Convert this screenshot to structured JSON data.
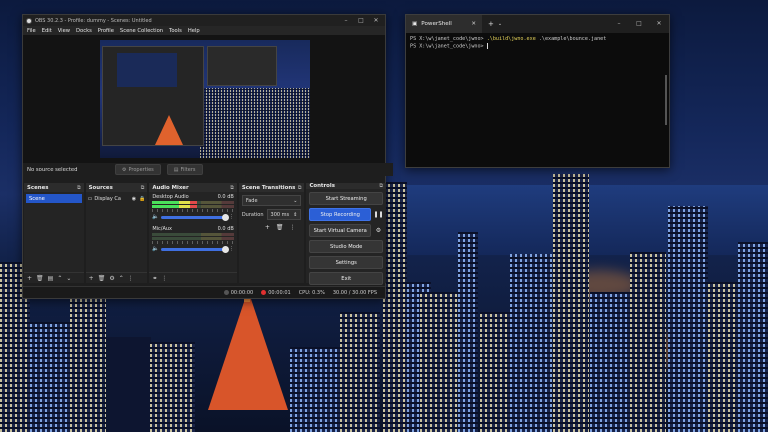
{
  "obs": {
    "title": "OBS 30.2.3 - Profile: dummy - Scenes: Untitled",
    "menu": [
      "File",
      "Edit",
      "View",
      "Docks",
      "Profile",
      "Scene Collection",
      "Tools",
      "Help"
    ],
    "source_bar": {
      "no_source": "No source selected",
      "properties": "Properties",
      "filters": "Filters"
    },
    "scenes": {
      "header": "Scenes",
      "items": [
        "Scene"
      ]
    },
    "sources": {
      "header": "Sources",
      "items": [
        "Display Ca"
      ]
    },
    "audio_mixer": {
      "header": "Audio Mixer",
      "channels": [
        {
          "name": "Desktop Audio",
          "db": "0.0 dB",
          "level": 0.55
        },
        {
          "name": "Mic/Aux",
          "db": "0.0 dB",
          "level": 0.0
        }
      ]
    },
    "transitions": {
      "header": "Scene Transitions",
      "type": "Fade",
      "duration_label": "Duration",
      "duration_value": "300 ms"
    },
    "controls": {
      "header": "Controls",
      "start_streaming": "Start Streaming",
      "stop_recording": "Stop Recording",
      "start_virtual_camera": "Start Virtual Camera",
      "studio_mode": "Studio Mode",
      "settings": "Settings",
      "exit": "Exit"
    },
    "status": {
      "stream_time": "00:00:00",
      "record_time": "00:00:01",
      "cpu": "CPU: 0.3%",
      "fps": "30.00 / 30.00 FPS"
    }
  },
  "powershell": {
    "tab_title": "PowerShell",
    "lines": [
      {
        "prompt": "PS X:\\w\\janet_code\\jwno>",
        "exe": ".\\build\\jwno.exe",
        "args": ".\\example\\bounce.janet"
      },
      {
        "prompt": "PS X:\\w\\janet_code\\jwno>",
        "exe": "",
        "args": ""
      }
    ]
  },
  "colors": {
    "accent": "#2b5fd6",
    "recording": "#e03030",
    "terminal_exe": "#e5d35a"
  }
}
